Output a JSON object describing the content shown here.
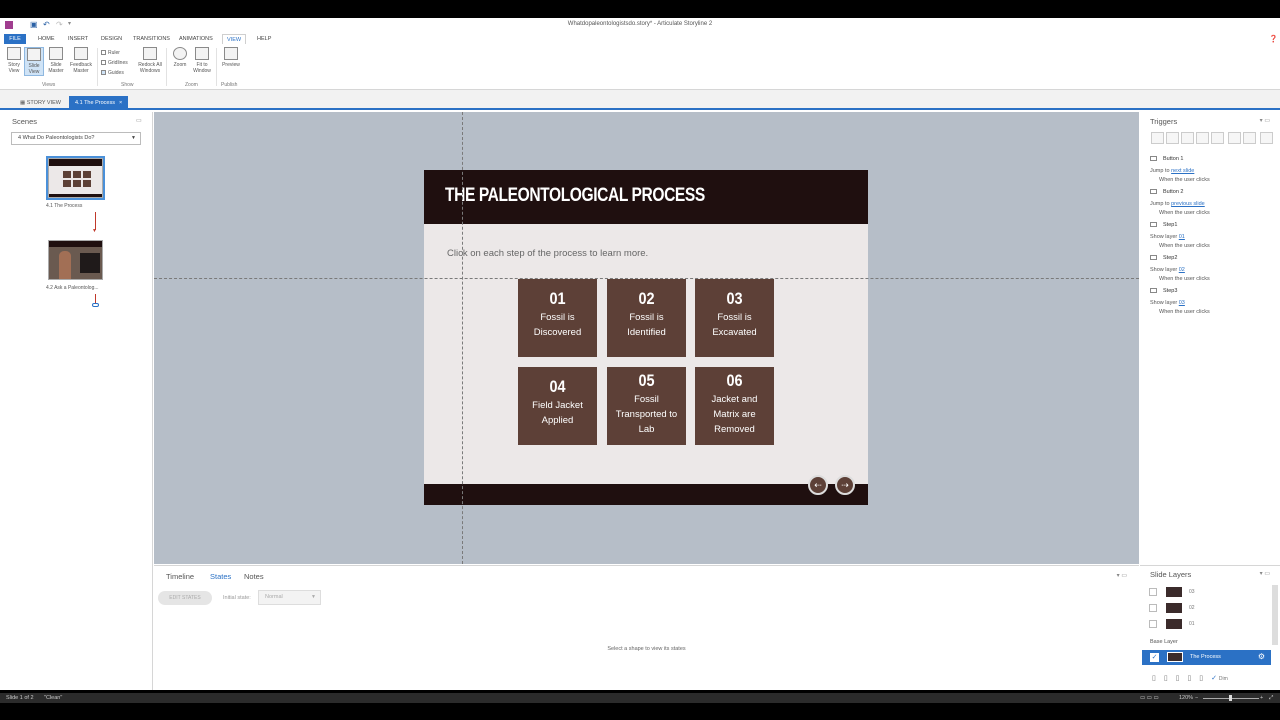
{
  "window": {
    "title": "Whatdopaleontologistsdo.story* - Articulate Storyline 2"
  },
  "menu": {
    "tabs": [
      "FILE",
      "HOME",
      "INSERT",
      "DESIGN",
      "TRANSITIONS",
      "ANIMATIONS",
      "VIEW",
      "HELP"
    ],
    "active": "VIEW"
  },
  "ribbon": {
    "views": {
      "story_view": "Story View",
      "slide_view": "Slide View",
      "slide_master": "Slide Master",
      "feedback_master": "Feedback Master",
      "group": "Views"
    },
    "show": {
      "ruler": "Ruler",
      "gridlines": "Gridlines",
      "guides": "Guides",
      "redock": "Redock All Windows",
      "group": "Show"
    },
    "zoom": {
      "zoom": "Zoom",
      "fit": "Fit to Window",
      "group": "Zoom"
    },
    "publish": {
      "preview": "Preview",
      "group": "Publish"
    }
  },
  "viewtabs": {
    "story": "STORY VIEW",
    "current": "4.1 The Process"
  },
  "scenes": {
    "title": "Scenes",
    "selected": "4 What Do Paleontologists Do?",
    "slides": [
      {
        "label": "4.1 The Process"
      },
      {
        "label": "4.2 Ask a Paleontolog..."
      }
    ]
  },
  "slide": {
    "title": "THE PALEONTOLOGICAL PROCESS",
    "instruction": "Click on each step of the process to learn more.",
    "steps": [
      {
        "num": "01",
        "text": "Fossil is Discovered"
      },
      {
        "num": "02",
        "text": "Fossil is Identified"
      },
      {
        "num": "03",
        "text": "Fossil is Excavated"
      },
      {
        "num": "04",
        "text": "Field Jacket Applied"
      },
      {
        "num": "05",
        "text": "Fossil Transported to Lab"
      },
      {
        "num": "06",
        "text": "Jacket and Matrix are Removed"
      }
    ],
    "prev_arrow": "⇠",
    "next_arrow": "⇢"
  },
  "bottom": {
    "tabs": {
      "timeline": "Timeline",
      "states": "States",
      "notes": "Notes"
    },
    "edit_states": "EDIT STATES",
    "initial_state_label": "Initial state:",
    "initial_state_value": "Normal",
    "hint": "Select a shape to view its states"
  },
  "triggers": {
    "title": "Triggers",
    "items": [
      {
        "name": "Button 1",
        "action": "Jump to",
        "link": "next slide",
        "when": "When the user clicks"
      },
      {
        "name": "Button 2",
        "action": "Jump to",
        "link": "previous slide",
        "when": "When the user clicks"
      },
      {
        "name": "Step1",
        "action": "Show layer",
        "link": "01",
        "when": "When the user clicks"
      },
      {
        "name": "Step2",
        "action": "Show layer",
        "link": "02",
        "when": "When the user clicks"
      },
      {
        "name": "Step3",
        "action": "Show layer",
        "link": "03",
        "when": "When the user clicks"
      }
    ]
  },
  "layers": {
    "title": "Slide Layers",
    "items": [
      "03",
      "02",
      "01"
    ],
    "base_label": "Base Layer",
    "base_name": "The Process",
    "dim": "Dim"
  },
  "status": {
    "slide": "Slide 1 of 2",
    "theme": "\"Clean\"",
    "zoom": "120%"
  }
}
